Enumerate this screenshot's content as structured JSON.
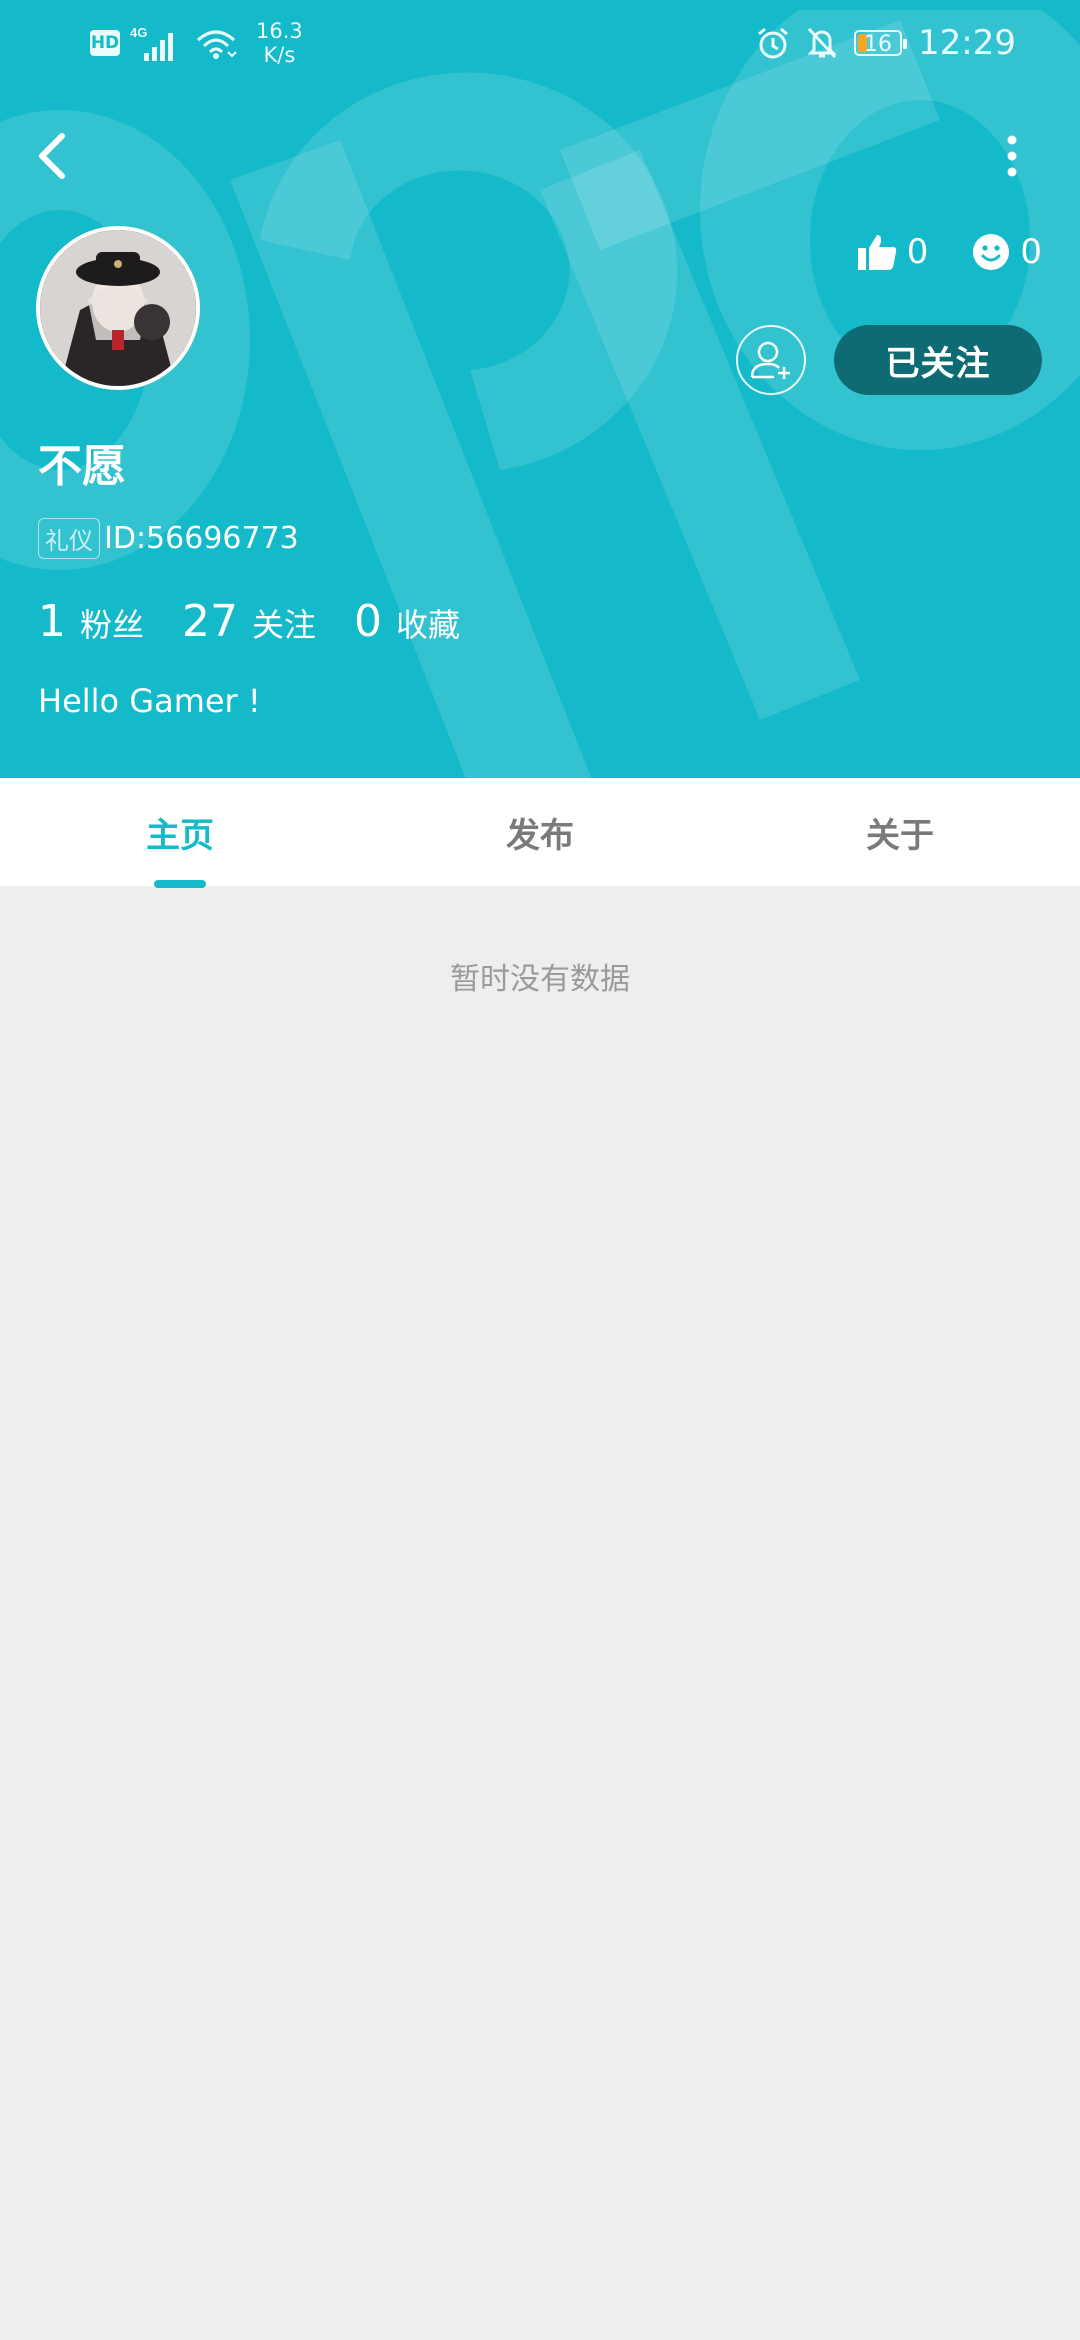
{
  "status_bar": {
    "hd_label": "HD",
    "network_type": "4G",
    "net_speed_value": "16.3",
    "net_speed_unit": "K/s",
    "battery_level": "16",
    "time": "12:29",
    "icons": [
      "signal-icon",
      "wifi-icon",
      "alarm-icon",
      "mute-bell-icon",
      "battery-icon"
    ]
  },
  "nav": {
    "back_icon": "chevron-left-icon",
    "more_icon": "more-vertical-icon"
  },
  "profile": {
    "username": "不愿",
    "tag_label": "礼仪",
    "user_id": "ID:56696773",
    "bio": "Hello Gamer !",
    "likes_count": "0",
    "emoji_count": "0",
    "follow_button_label": "已关注",
    "stats": [
      {
        "value": "1",
        "label": "粉丝"
      },
      {
        "value": "27",
        "label": "关注"
      },
      {
        "value": "0",
        "label": "收藏"
      }
    ]
  },
  "tabs": [
    {
      "label": "主页",
      "active": true
    },
    {
      "label": "发布",
      "active": false
    },
    {
      "label": "关于",
      "active": false
    }
  ],
  "content": {
    "empty_message": "暂时没有数据"
  },
  "colors": {
    "header_bg": "#14b9ca",
    "follow_btn_bg": "#0e6b74",
    "page_bg": "#eeeeee",
    "tab_active": "#14b9ca"
  }
}
